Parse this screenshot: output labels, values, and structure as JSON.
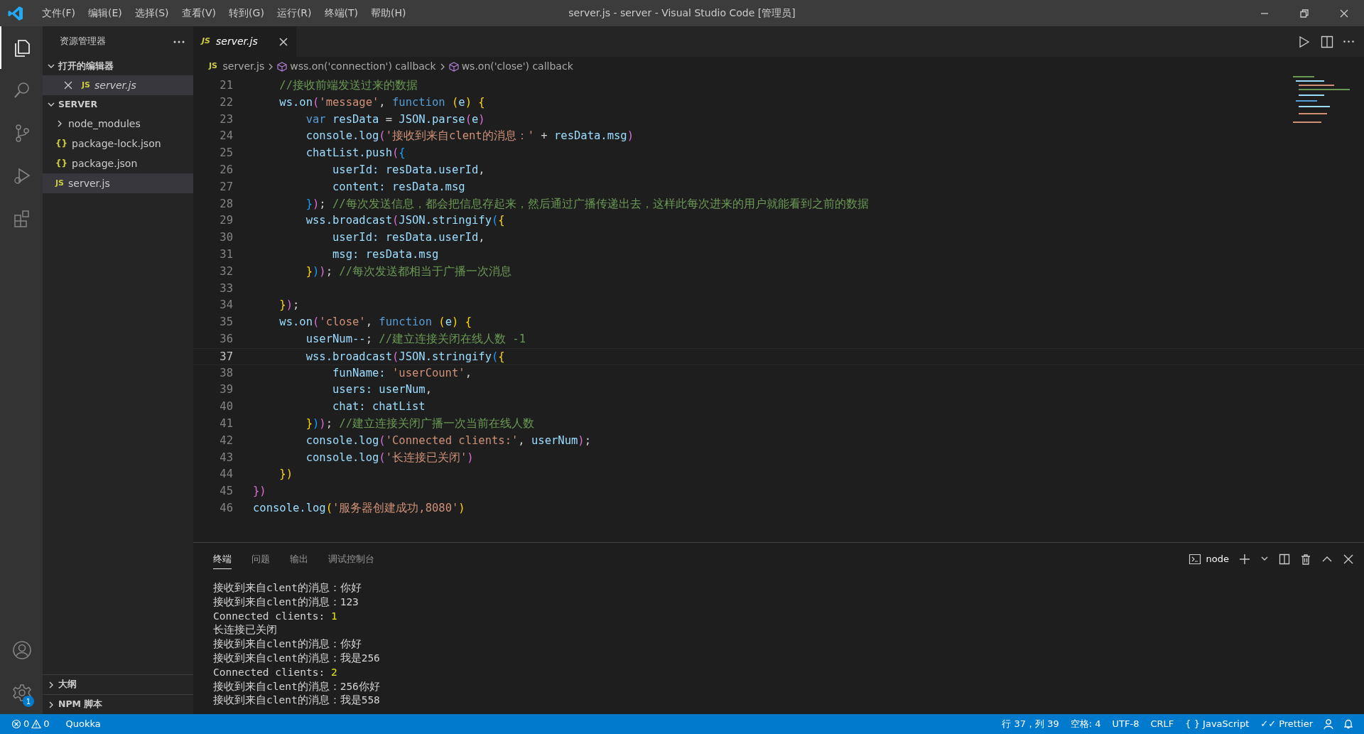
{
  "window": {
    "title": "server.js - server - Visual Studio Code [管理员]"
  },
  "menu": [
    "文件(F)",
    "编辑(E)",
    "选择(S)",
    "查看(V)",
    "转到(G)",
    "运行(R)",
    "终端(T)",
    "帮助(H)"
  ],
  "activity_bar": [
    {
      "kind": "files",
      "selected": true
    },
    {
      "kind": "search",
      "selected": false
    },
    {
      "kind": "scm",
      "selected": false
    },
    {
      "kind": "debug",
      "selected": false
    },
    {
      "kind": "extensions",
      "selected": false
    }
  ],
  "activity_badge": "1",
  "sidebar": {
    "title": "资源管理器",
    "open_editors": {
      "label": "打开的编辑器",
      "expanded": true,
      "items": [
        {
          "icon": "JS",
          "name": "server.js"
        }
      ]
    },
    "folder": {
      "label": "SERVER",
      "expanded": true,
      "items": [
        {
          "kind": "folder",
          "name": "node_modules",
          "selected": false
        },
        {
          "kind": "json",
          "icon": "{}",
          "name": "package-lock.json",
          "selected": false
        },
        {
          "kind": "json",
          "icon": "{}",
          "name": "package.json",
          "selected": false
        },
        {
          "kind": "js",
          "icon": "JS",
          "name": "server.js",
          "selected": true
        }
      ]
    },
    "bottom_sections": [
      {
        "label": "大纲",
        "expanded": false
      },
      {
        "label": "NPM 脚本",
        "expanded": false
      }
    ]
  },
  "tabs": [
    {
      "icon": "JS",
      "label": "server.js",
      "selected": true
    }
  ],
  "breadcrumbs": [
    {
      "kind": "file",
      "icon": "JS",
      "label": "server.js"
    },
    {
      "kind": "symbol",
      "label": "wss.on('connection') callback"
    },
    {
      "kind": "symbol",
      "label": "ws.on('close') callback"
    }
  ],
  "code": [
    {
      "n": "21",
      "active": false,
      "tokens": [
        {
          "text": "    //接收前端发送过来的数据",
          "kind": "comment"
        }
      ]
    },
    {
      "n": "22",
      "active": false,
      "tokens": [
        {
          "text": "    ws.on",
          "kind": "var"
        },
        {
          "text": "(",
          "kind": "b2"
        },
        {
          "text": "'message'",
          "kind": "string"
        },
        {
          "text": ", ",
          "kind": "plain"
        },
        {
          "text": "function ",
          "kind": "keyword"
        },
        {
          "text": "(",
          "kind": "b1"
        },
        {
          "text": "e",
          "kind": "var"
        },
        {
          "text": ") {",
          "kind": "b1"
        }
      ]
    },
    {
      "n": "23",
      "active": false,
      "tokens": [
        {
          "text": "        var ",
          "kind": "keyword"
        },
        {
          "text": "resData",
          "kind": "var"
        },
        {
          "text": " = ",
          "kind": "plain"
        },
        {
          "text": "JSON.parse",
          "kind": "var"
        },
        {
          "text": "(",
          "kind": "b2"
        },
        {
          "text": "e",
          "kind": "var"
        },
        {
          "text": ")",
          "kind": "b2"
        }
      ]
    },
    {
      "n": "24",
      "active": false,
      "tokens": [
        {
          "text": "        console.log",
          "kind": "var"
        },
        {
          "text": "(",
          "kind": "b2"
        },
        {
          "text": "'接收到来自clent的消息：'",
          "kind": "string"
        },
        {
          "text": " + ",
          "kind": "plain"
        },
        {
          "text": "resData.msg",
          "kind": "var"
        },
        {
          "text": ")",
          "kind": "b2"
        }
      ]
    },
    {
      "n": "25",
      "active": false,
      "tokens": [
        {
          "text": "        chatList.push",
          "kind": "var"
        },
        {
          "text": "(",
          "kind": "b2"
        },
        {
          "text": "{",
          "kind": "b3"
        }
      ]
    },
    {
      "n": "26",
      "active": false,
      "tokens": [
        {
          "text": "            userId: resData.userId",
          "kind": "var"
        },
        {
          "text": ",",
          "kind": "plain"
        }
      ]
    },
    {
      "n": "27",
      "active": false,
      "tokens": [
        {
          "text": "            content: resData.msg",
          "kind": "var"
        }
      ]
    },
    {
      "n": "28",
      "active": false,
      "tokens": [
        {
          "text": "        }",
          "kind": "b3"
        },
        {
          "text": ")",
          "kind": "b2"
        },
        {
          "text": "; ",
          "kind": "plain"
        },
        {
          "text": "//每次发送信息，都会把信息存起来，然后通过广播传递出去，这样此每次进来的用户就能看到之前的数据",
          "kind": "comment"
        }
      ]
    },
    {
      "n": "29",
      "active": false,
      "tokens": [
        {
          "text": "        wss.broadcast",
          "kind": "var"
        },
        {
          "text": "(",
          "kind": "b2"
        },
        {
          "text": "JSON.stringify",
          "kind": "var"
        },
        {
          "text": "(",
          "kind": "b3"
        },
        {
          "text": "{",
          "kind": "b1"
        }
      ]
    },
    {
      "n": "30",
      "active": false,
      "tokens": [
        {
          "text": "            userId: resData.userId",
          "kind": "var"
        },
        {
          "text": ",",
          "kind": "plain"
        }
      ]
    },
    {
      "n": "31",
      "active": false,
      "tokens": [
        {
          "text": "            msg: resData.msg",
          "kind": "var"
        }
      ]
    },
    {
      "n": "32",
      "active": false,
      "tokens": [
        {
          "text": "        }",
          "kind": "b1"
        },
        {
          "text": ")",
          "kind": "b3"
        },
        {
          "text": ")",
          "kind": "b2"
        },
        {
          "text": "; ",
          "kind": "plain"
        },
        {
          "text": "//每次发送都相当于广播一次消息",
          "kind": "comment"
        }
      ]
    },
    {
      "n": "33",
      "active": false
    },
    {
      "n": "34",
      "active": false,
      "tokens": [
        {
          "text": "    }",
          "kind": "b1"
        },
        {
          "text": ")",
          "kind": "b2"
        },
        {
          "text": ";",
          "kind": "plain"
        }
      ]
    },
    {
      "n": "35",
      "active": false,
      "tokens": [
        {
          "text": "    ws.on",
          "kind": "var"
        },
        {
          "text": "(",
          "kind": "b2"
        },
        {
          "text": "'close'",
          "kind": "string"
        },
        {
          "text": ", ",
          "kind": "plain"
        },
        {
          "text": "function ",
          "kind": "keyword"
        },
        {
          "text": "(",
          "kind": "b1"
        },
        {
          "text": "e",
          "kind": "var"
        },
        {
          "text": ") {",
          "kind": "b1"
        }
      ]
    },
    {
      "n": "36",
      "active": false,
      "tokens": [
        {
          "text": "        userNum--",
          "kind": "var"
        },
        {
          "text": "; ",
          "kind": "plain"
        },
        {
          "text": "//建立连接关闭在线人数 -1",
          "kind": "comment"
        }
      ]
    },
    {
      "n": "37",
      "active": true,
      "tokens": [
        {
          "text": "        wss.broadcast",
          "kind": "var"
        },
        {
          "text": "(",
          "kind": "b2"
        },
        {
          "text": "JSON.stringify",
          "kind": "var"
        },
        {
          "text": "(",
          "kind": "b3"
        },
        {
          "text": "{",
          "kind": "b1"
        }
      ]
    },
    {
      "n": "38",
      "active": false,
      "tokens": [
        {
          "text": "            funName: ",
          "kind": "var"
        },
        {
          "text": "'userCount'",
          "kind": "string"
        },
        {
          "text": ",",
          "kind": "plain"
        }
      ]
    },
    {
      "n": "39",
      "active": false,
      "tokens": [
        {
          "text": "            users: userNum",
          "kind": "var"
        },
        {
          "text": ",",
          "kind": "plain"
        }
      ]
    },
    {
      "n": "40",
      "active": false,
      "tokens": [
        {
          "text": "            chat: chatList",
          "kind": "var"
        }
      ]
    },
    {
      "n": "41",
      "active": false,
      "tokens": [
        {
          "text": "        }",
          "kind": "b1"
        },
        {
          "text": ")",
          "kind": "b3"
        },
        {
          "text": ")",
          "kind": "b2"
        },
        {
          "text": "; ",
          "kind": "plain"
        },
        {
          "text": "//建立连接关闭广播一次当前在线人数",
          "kind": "comment"
        }
      ]
    },
    {
      "n": "42",
      "active": false,
      "tokens": [
        {
          "text": "        console.log",
          "kind": "var"
        },
        {
          "text": "(",
          "kind": "b2"
        },
        {
          "text": "'Connected clients:'",
          "kind": "string"
        },
        {
          "text": ", ",
          "kind": "plain"
        },
        {
          "text": "userNum",
          "kind": "var"
        },
        {
          "text": ")",
          "kind": "b2"
        },
        {
          "text": ";",
          "kind": "plain"
        }
      ]
    },
    {
      "n": "43",
      "active": false,
      "tokens": [
        {
          "text": "        console.log",
          "kind": "var"
        },
        {
          "text": "(",
          "kind": "b2"
        },
        {
          "text": "'长连接已关闭'",
          "kind": "string"
        },
        {
          "text": ")",
          "kind": "b2"
        }
      ]
    },
    {
      "n": "44",
      "active": false,
      "tokens": [
        {
          "text": "    }",
          "kind": "b1"
        },
        {
          "text": ")",
          "kind": "b1"
        }
      ]
    },
    {
      "n": "45",
      "active": false,
      "tokens": [
        {
          "text": "}",
          "kind": "b2"
        },
        {
          "text": ")",
          "kind": "b2"
        }
      ]
    },
    {
      "n": "46",
      "active": false,
      "tokens": [
        {
          "text": "console.log",
          "kind": "var"
        },
        {
          "text": "(",
          "kind": "b1"
        },
        {
          "text": "'服务器创建成功,8080'",
          "kind": "string"
        },
        {
          "text": ")",
          "kind": "b1"
        }
      ]
    }
  ],
  "panel": {
    "tabs": [
      {
        "label": "终端",
        "selected": true
      },
      {
        "label": "问题",
        "selected": false
      },
      {
        "label": "输出",
        "selected": false
      },
      {
        "label": "调试控制台",
        "selected": false
      }
    ],
    "terminal_name": "node",
    "lines": [
      {
        "parts": [
          {
            "text": "接收到来自clent的消息：你好",
            "kind": "plain"
          }
        ]
      },
      {
        "parts": [
          {
            "text": "接收到来自clent的消息：123",
            "kind": "plain"
          }
        ]
      },
      {
        "parts": [
          {
            "text": "Connected clients: ",
            "kind": "plain"
          },
          {
            "text": "1",
            "kind": "number"
          }
        ]
      },
      {
        "parts": [
          {
            "text": "长连接已关闭",
            "kind": "plain"
          }
        ]
      },
      {
        "parts": [
          {
            "text": "接收到来自clent的消息：你好",
            "kind": "plain"
          }
        ]
      },
      {
        "parts": [
          {
            "text": "接收到来自clent的消息：我是256",
            "kind": "plain"
          }
        ]
      },
      {
        "parts": [
          {
            "text": "Connected clients: ",
            "kind": "plain"
          },
          {
            "text": "2",
            "kind": "number"
          }
        ]
      },
      {
        "parts": [
          {
            "text": "接收到来自clent的消息：256你好",
            "kind": "plain"
          }
        ]
      },
      {
        "parts": [
          {
            "text": "接收到来自clent的消息：我是558",
            "kind": "plain"
          }
        ]
      }
    ]
  },
  "status_bar": {
    "errors": "0",
    "warnings": "0",
    "left": [
      "Quokka"
    ],
    "right": [
      {
        "kind": "text",
        "label": "行 37，列 39"
      },
      {
        "kind": "text",
        "label": "空格: 4"
      },
      {
        "kind": "text",
        "label": "UTF-8"
      },
      {
        "kind": "text",
        "label": "CRLF"
      },
      {
        "kind": "text",
        "label": "{ } JavaScript"
      },
      {
        "kind": "text",
        "label": "✓✓ Prettier"
      },
      {
        "kind": "person"
      },
      {
        "kind": "bell"
      }
    ]
  }
}
